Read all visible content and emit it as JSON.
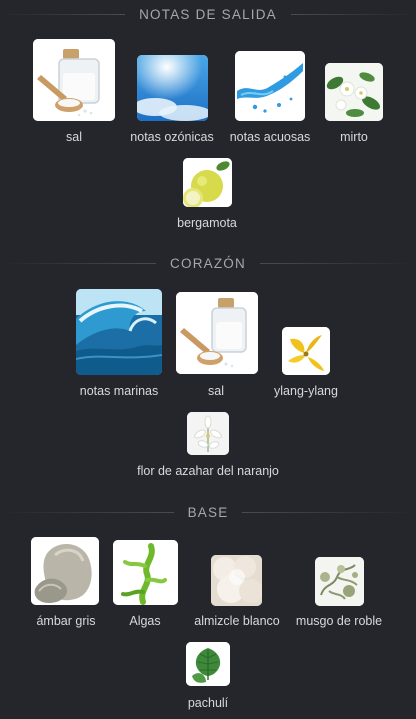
{
  "sections": {
    "top": {
      "title": "NOTAS DE SALIDA",
      "notes": [
        {
          "label": "sal",
          "icon": "salt-jar-icon"
        },
        {
          "label": "notas ozónicas",
          "icon": "sky-icon"
        },
        {
          "label": "notas acuosas",
          "icon": "water-splash-icon"
        },
        {
          "label": "mirto",
          "icon": "myrtle-flower-icon"
        },
        {
          "label": "bergamota",
          "icon": "bergamot-fruit-icon"
        }
      ]
    },
    "heart": {
      "title": "CORAZÓN",
      "notes": [
        {
          "label": "notas marinas",
          "icon": "ocean-wave-icon"
        },
        {
          "label": "sal",
          "icon": "salt-jar-icon"
        },
        {
          "label": "ylang-ylang",
          "icon": "ylang-flower-icon"
        },
        {
          "label": "flor de azahar del naranjo",
          "icon": "orange-blossom-icon"
        }
      ]
    },
    "base": {
      "title": "BASE",
      "notes": [
        {
          "label": "ámbar gris",
          "icon": "ambergris-stone-icon"
        },
        {
          "label": "Algas",
          "icon": "seaweed-icon"
        },
        {
          "label": "almizcle blanco",
          "icon": "white-musk-icon"
        },
        {
          "label": "musgo de roble",
          "icon": "oakmoss-icon"
        },
        {
          "label": "pachulí",
          "icon": "patchouli-leaf-icon"
        }
      ]
    }
  },
  "colors": {
    "background": "#25252c",
    "header_text": "#a6a6ae",
    "label_text": "#d8d8dc"
  }
}
